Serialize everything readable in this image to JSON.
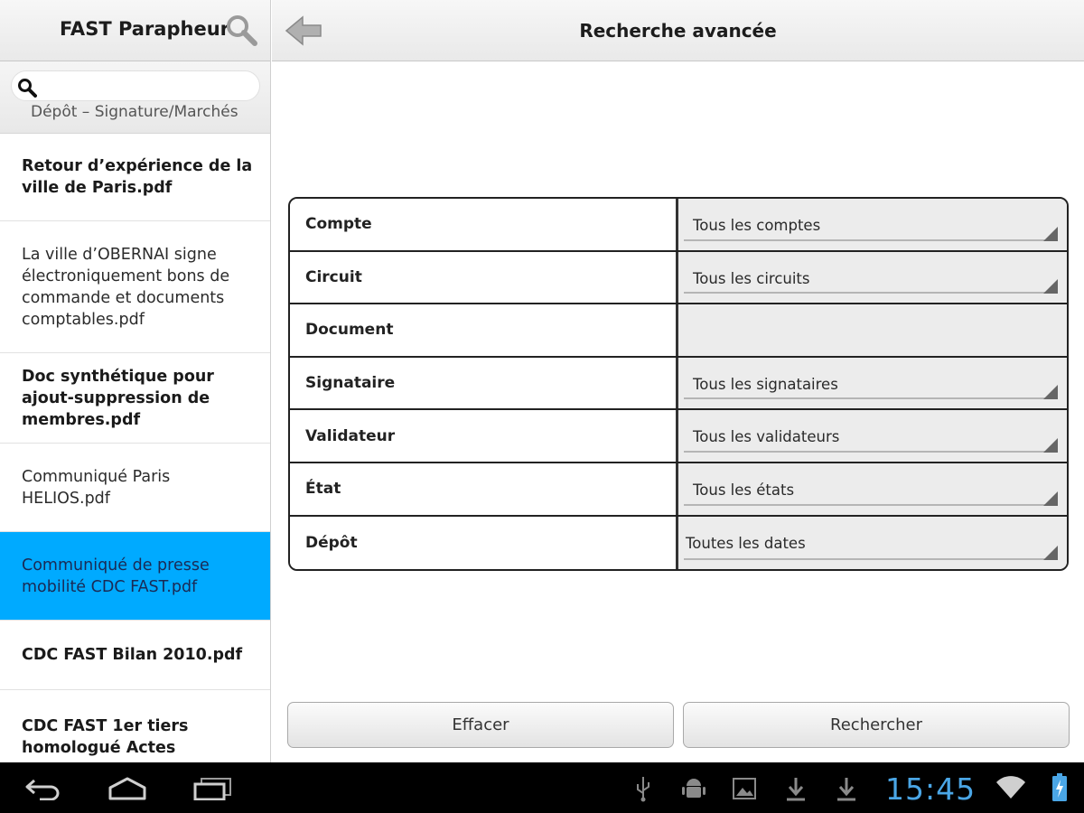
{
  "sidebar": {
    "title": "FAST Parapheur",
    "search_placeholder": "",
    "peek_text": "Dépôt – Signature/Marchés",
    "items": [
      {
        "label": "Retour d’expérience de la ville de Paris.pdf"
      },
      {
        "label": "La ville d’OBERNAI signe électroniquement bons de commande et documents comptables.pdf"
      },
      {
        "label": "Doc synthétique pour ajout-suppression de membres.pdf"
      },
      {
        "label": "Communiqué Paris HELIOS.pdf"
      },
      {
        "label": "Communiqué de presse mobilité CDC FAST.pdf"
      },
      {
        "label": "CDC FAST Bilan 2010.pdf"
      },
      {
        "label": "CDC FAST 1er tiers homologué Actes"
      }
    ]
  },
  "header": {
    "title": "Recherche avancée"
  },
  "form": {
    "rows": [
      {
        "label": "Compte",
        "value": "Tous les comptes"
      },
      {
        "label": "Circuit",
        "value": "Tous les circuits"
      },
      {
        "label": "Document",
        "value": ""
      },
      {
        "label": "Signataire",
        "value": "Tous les signataires"
      },
      {
        "label": "Validateur",
        "value": "Tous les validateurs"
      },
      {
        "label": "État",
        "value": "Tous les états"
      },
      {
        "label": "Dépôt",
        "value": "Toutes les dates"
      }
    ]
  },
  "buttons": {
    "clear": "Effacer",
    "search": "Rechercher"
  },
  "status_bar": {
    "time": "15:45",
    "icons": [
      "back-icon",
      "home-icon",
      "recent-apps-icon",
      "usb-icon",
      "android-debug-icon",
      "image-icon",
      "download-icon",
      "download-icon",
      "wifi-icon",
      "battery-charging-icon"
    ]
  },
  "colors": {
    "selected": "#00aaff",
    "clock": "#4aa6e6"
  }
}
